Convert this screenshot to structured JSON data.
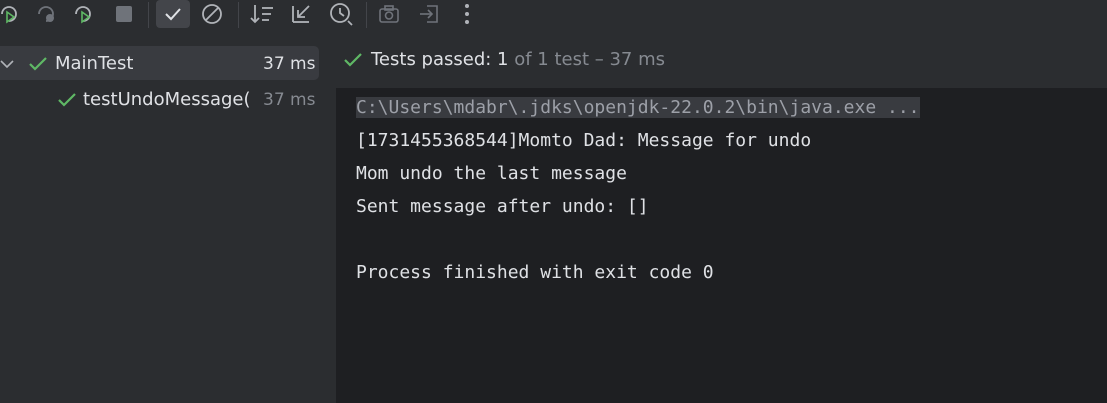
{
  "colors": {
    "pass_green": "#5fb865",
    "icon_gray": "#b0b3b8",
    "icon_disabled": "#6f737a"
  },
  "toolbar": {
    "icons": [
      "rerun-icon",
      "rerun-failed-icon",
      "toggle-auto-test-icon",
      "stop-icon",
      "show-passed-icon",
      "show-ignored-icon",
      "sort-alphabetically-icon",
      "collapse-all-icon",
      "sort-by-duration-icon",
      "screenshot-icon",
      "import-tests-icon",
      "more-options-icon"
    ]
  },
  "tree": {
    "root": {
      "label": "MainTest",
      "time": "37 ms"
    },
    "child": {
      "label": "testUndoMessage(",
      "time": "37 ms"
    }
  },
  "status": {
    "prefix": "Tests passed: ",
    "count": "1",
    "suffix": " of 1 test – 37 ms"
  },
  "console": {
    "lines": [
      "C:\\Users\\mdabr\\.jdks\\openjdk-22.0.2\\bin\\java.exe ...",
      "[1731455368544]Momto Dad: Message for undo",
      "Mom undo the last message",
      "Sent message after undo: []",
      "",
      "Process finished with exit code 0"
    ]
  }
}
